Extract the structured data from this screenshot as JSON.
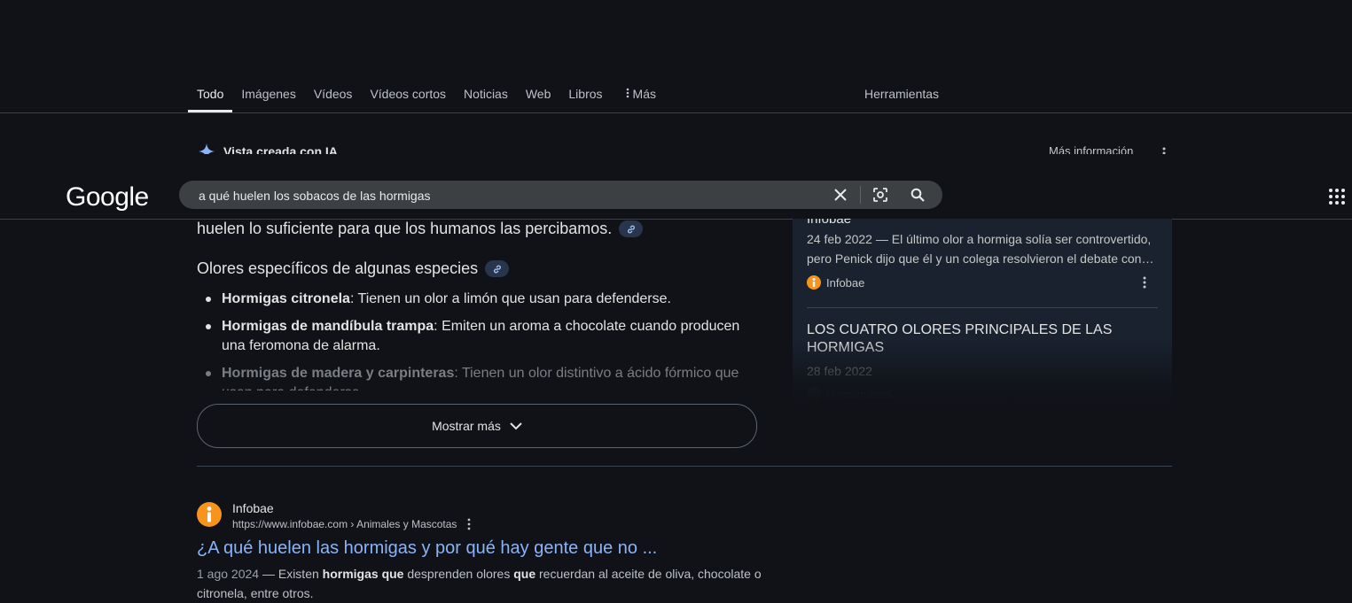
{
  "tabs": {
    "items": [
      {
        "label": "Todo",
        "active": true
      },
      {
        "label": "Imágenes"
      },
      {
        "label": "Vídeos"
      },
      {
        "label": "Vídeos cortos"
      },
      {
        "label": "Noticias"
      },
      {
        "label": "Web"
      },
      {
        "label": "Libros"
      }
    ],
    "more_label": "Más",
    "tools_label": "Herramientas"
  },
  "ai": {
    "header_title": "Vista creada con IA",
    "more_info": "Más información",
    "text_line": "huelen lo suficiente para que los humanos las percibamos.",
    "subheading": "Olores específicos de algunas especies",
    "bullets": [
      {
        "bold": "Hormigas citronela",
        "text": ": Tienen un olor a limón que usan para defenderse."
      },
      {
        "bold": "Hormigas de mandíbula trampa",
        "text": ": Emiten un aroma a chocolate cuando producen una feromona de alarma."
      },
      {
        "bold": "Hormigas de madera y carpinteras",
        "text": ": Tienen un olor distintivo a ácido fórmico que usan para defenderse."
      }
    ],
    "show_more": "Mostrar más"
  },
  "search": {
    "logo": "Google",
    "query": "a qué huelen los sobacos de las hormigas"
  },
  "panel": {
    "cut_title": "Infobae",
    "card1": {
      "snippet": "24 feb 2022 — El último olor a hormiga solía ser controvertido, pero Penick dijo que él y un colega resolvieron el debate con…",
      "source": "Infobae"
    },
    "card2": {
      "title": "LOS CUATRO OLORES PRINCIPALES DE LAS HORMIGAS",
      "date": "28 feb 2022",
      "source": "Hormigueros"
    }
  },
  "result": {
    "site": "Infobae",
    "url": "https://www.infobae.com › Animales y Mascotas",
    "title": "¿A qué huelen las hormigas y por qué hay gente que no ...",
    "date": "1 ago 2024",
    "snippet_parts": [
      " — Existen ",
      "hormigas que",
      " desprenden olores ",
      "que",
      " recuerdan al aceite de oliva, chocolate o citronela, entre otros."
    ]
  },
  "colors": {
    "background": "#101218",
    "link": "#8ab4f8",
    "infobae_orange": "#f7941d"
  }
}
